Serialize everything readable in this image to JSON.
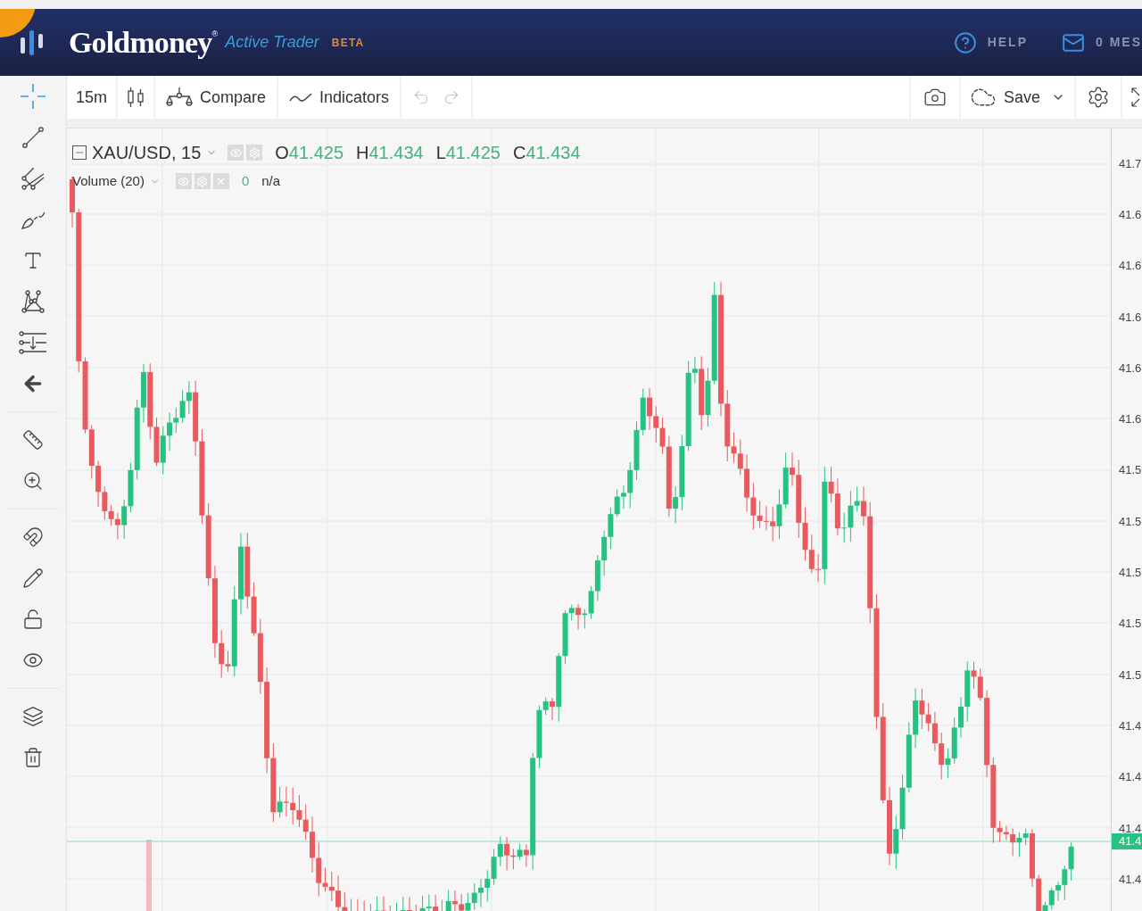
{
  "header": {
    "logo": "Goldmoney",
    "registered": "®",
    "product": "Active Trader",
    "badge": "BETA",
    "help": "HELP",
    "messages": "0 MES"
  },
  "toolbar": {
    "interval": "15m",
    "compare": "Compare",
    "indicators": "Indicators",
    "undo_disabled": true,
    "redo_disabled": true,
    "save": "Save"
  },
  "drawing_tools": [
    {
      "kind": "crosshair",
      "selected": true
    },
    {
      "kind": "line",
      "selected": false
    },
    {
      "kind": "fib",
      "selected": false
    },
    {
      "kind": "brush",
      "selected": false
    },
    {
      "kind": "text",
      "selected": false
    },
    {
      "kind": "pattern",
      "selected": false
    },
    {
      "kind": "measure",
      "selected": false
    },
    {
      "kind": "back",
      "selected": false
    },
    {
      "kind": "separator"
    },
    {
      "kind": "ruler",
      "selected": false
    },
    {
      "kind": "zoom",
      "selected": false
    },
    {
      "kind": "separator"
    },
    {
      "kind": "magnet",
      "selected": false
    },
    {
      "kind": "lock-drawing",
      "selected": false
    },
    {
      "kind": "unlock",
      "selected": false
    },
    {
      "kind": "eye",
      "selected": false
    },
    {
      "kind": "separator"
    },
    {
      "kind": "layers",
      "selected": false
    },
    {
      "kind": "trash",
      "selected": false
    }
  ],
  "legend": {
    "symbol": "XAU/USD, 15",
    "ohlc": [
      {
        "key": "O",
        "value": "41.425"
      },
      {
        "key": "H",
        "value": "41.434"
      },
      {
        "key": "L",
        "value": "41.425"
      },
      {
        "key": "C",
        "value": "41.434"
      }
    ]
  },
  "volume": {
    "label": "Volume (20)",
    "value": "0",
    "extra": "n/a"
  },
  "price_axis": {
    "labels": [
      "41.7",
      "41.6",
      "41.6",
      "41.6",
      "41.6",
      "41.6",
      "41.5",
      "41.5",
      "41.5",
      "41.5",
      "41.5",
      "41.4",
      "41.4",
      "41.4",
      "41.4"
    ],
    "last_price": "41.4"
  }
}
